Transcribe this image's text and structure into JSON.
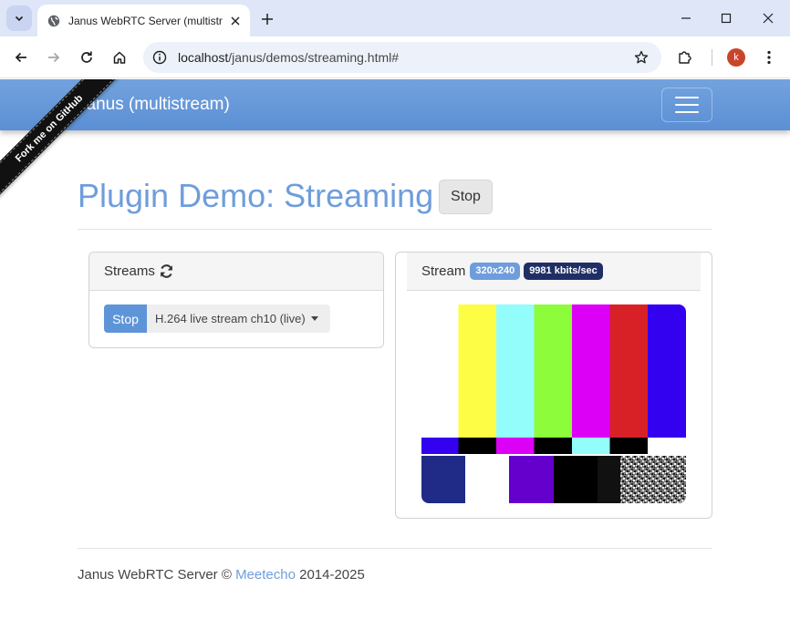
{
  "browser": {
    "tab_title": "Janus WebRTC Server (multistre",
    "url_host": "localhost",
    "url_path": "/janus/demos/streaming.html#",
    "profile_initial": "k"
  },
  "navbar": {
    "brand": "Janus (multistream)"
  },
  "ribbon": {
    "text": "Fork me on GitHub"
  },
  "header": {
    "title": "Plugin Demo: Streaming",
    "stop_label": "Stop"
  },
  "streams_panel": {
    "title": "Streams",
    "stop_label": "Stop",
    "selected_stream": "H.264 live stream ch10 (live)"
  },
  "stream_panel": {
    "title": "Stream",
    "resolution": "320x240",
    "bitrate": "9981 kbits/sec",
    "test_pattern_colors": [
      "#fdfd46",
      "#93fdfb",
      "#8cfc3b",
      "#dc00f7",
      "#d82127",
      "#3300f0"
    ]
  },
  "footer": {
    "prefix": "Janus WebRTC Server © ",
    "link": "Meetecho",
    "suffix": " 2014-2025"
  },
  "colors": {
    "accent": "#6f9ddb",
    "navbar": "#5b8fd4",
    "badge_dark": "#1f2f66"
  }
}
